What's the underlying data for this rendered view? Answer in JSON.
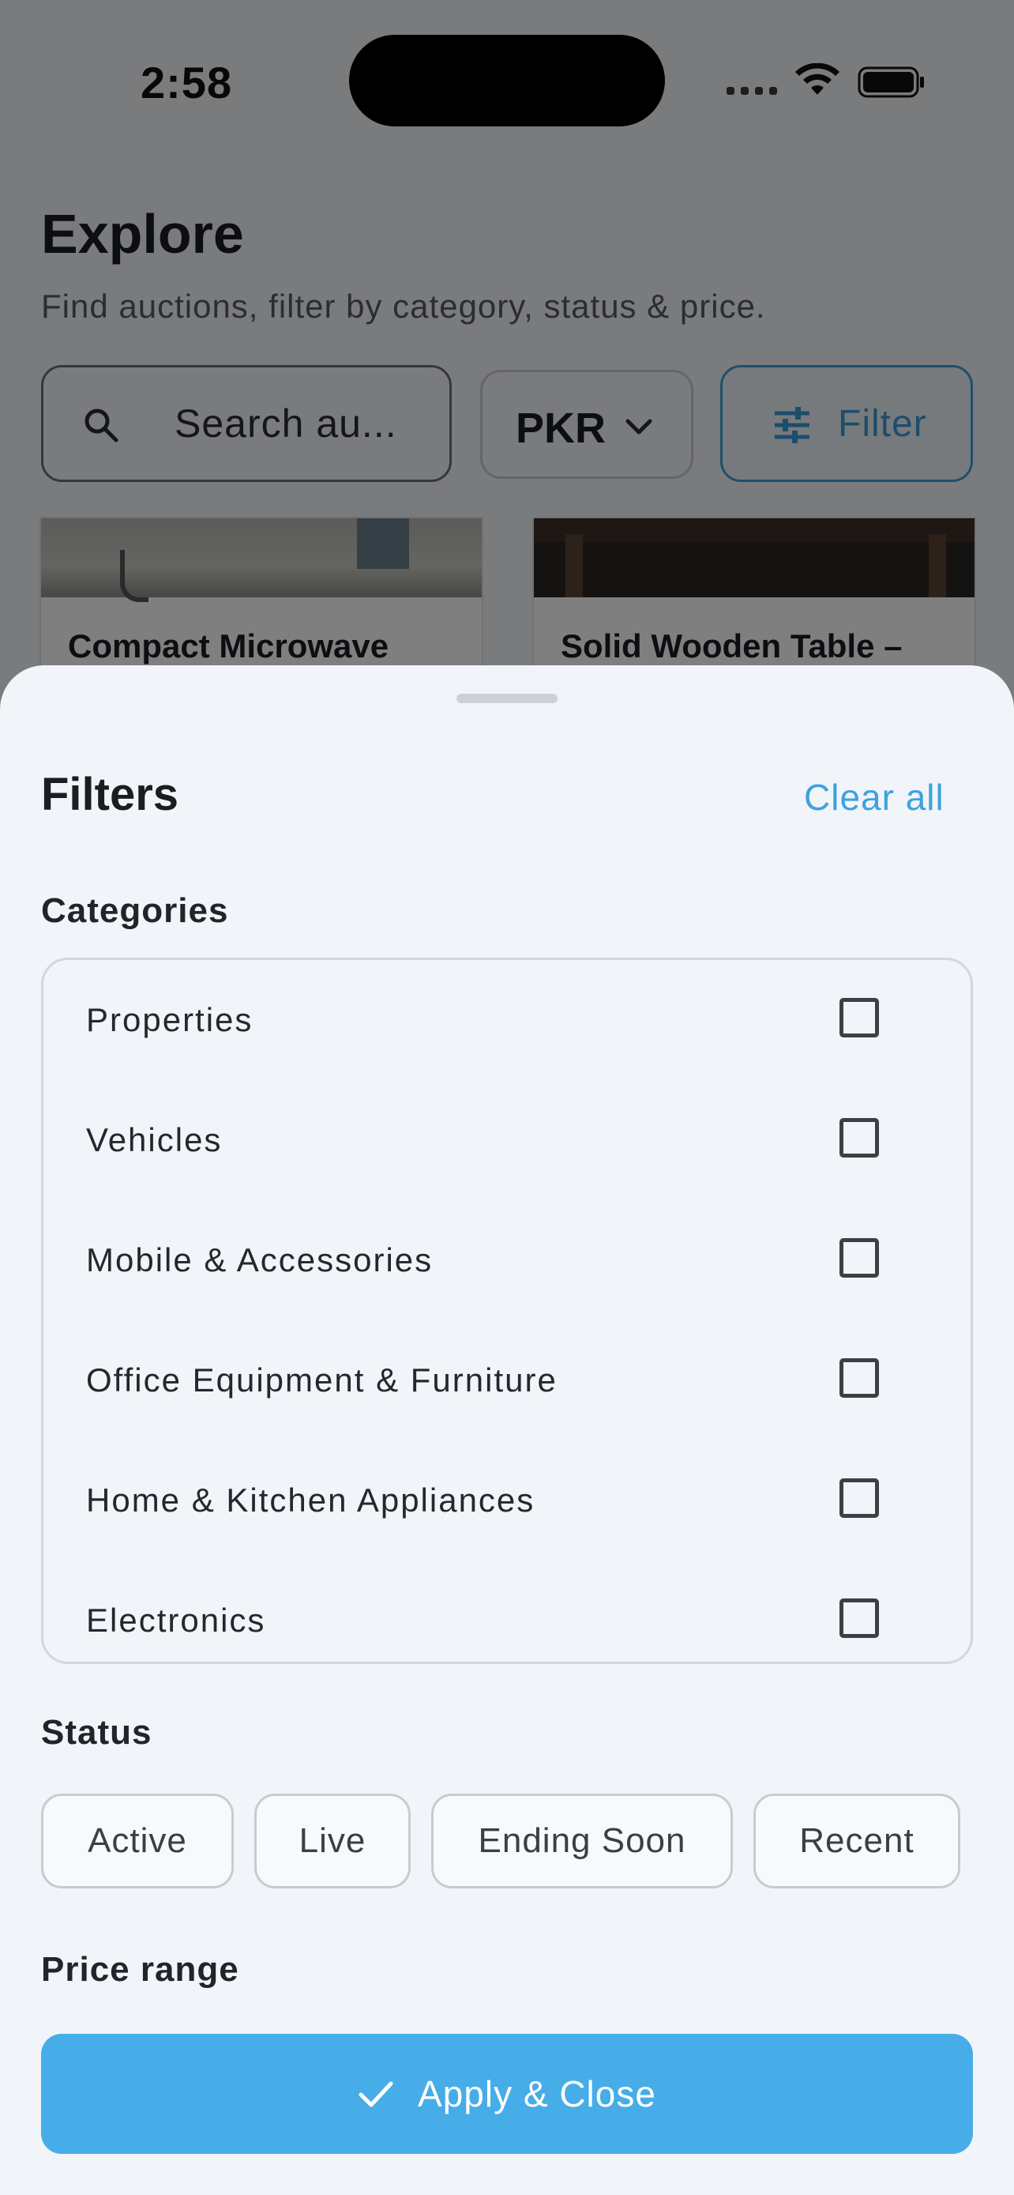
{
  "status_bar": {
    "time": "2:58",
    "icons": [
      "signal-dots-icon",
      "wifi-icon",
      "battery-icon"
    ]
  },
  "explore": {
    "title": "Explore",
    "subtitle": "Find auctions, filter by category, status & price.",
    "search": {
      "placeholder": "Search au...",
      "icon": "search-icon"
    },
    "currency": {
      "value": "PKR",
      "icon": "chevron-down-icon"
    },
    "filter_button": {
      "label": "Filter",
      "icon": "tune-icon"
    },
    "cards": [
      {
        "title": "Compact Microwave"
      },
      {
        "title": "Solid Wooden Table –"
      }
    ]
  },
  "filters_sheet": {
    "title": "Filters",
    "clear_all": "Clear all",
    "categories_heading": "Categories",
    "categories": [
      {
        "label": "Properties",
        "checked": false
      },
      {
        "label": "Vehicles",
        "checked": false
      },
      {
        "label": "Mobile & Accessories",
        "checked": false
      },
      {
        "label": "Office Equipment & Furniture",
        "checked": false
      },
      {
        "label": "Home & Kitchen Appliances",
        "checked": false
      },
      {
        "label": "Electronics",
        "checked": false
      }
    ],
    "status_heading": "Status",
    "status_options": [
      {
        "label": "Active"
      },
      {
        "label": "Live"
      },
      {
        "label": "Ending Soon"
      },
      {
        "label": "Recent"
      }
    ],
    "price_heading": "Price range",
    "apply_button": {
      "label": "Apply & Close",
      "icon": "check-icon"
    }
  },
  "colors": {
    "accent": "#46ade8",
    "link": "#3ba3de",
    "sheet_background": "#f1f4f9",
    "overlay": "rgba(0,0,0,0.5)"
  }
}
